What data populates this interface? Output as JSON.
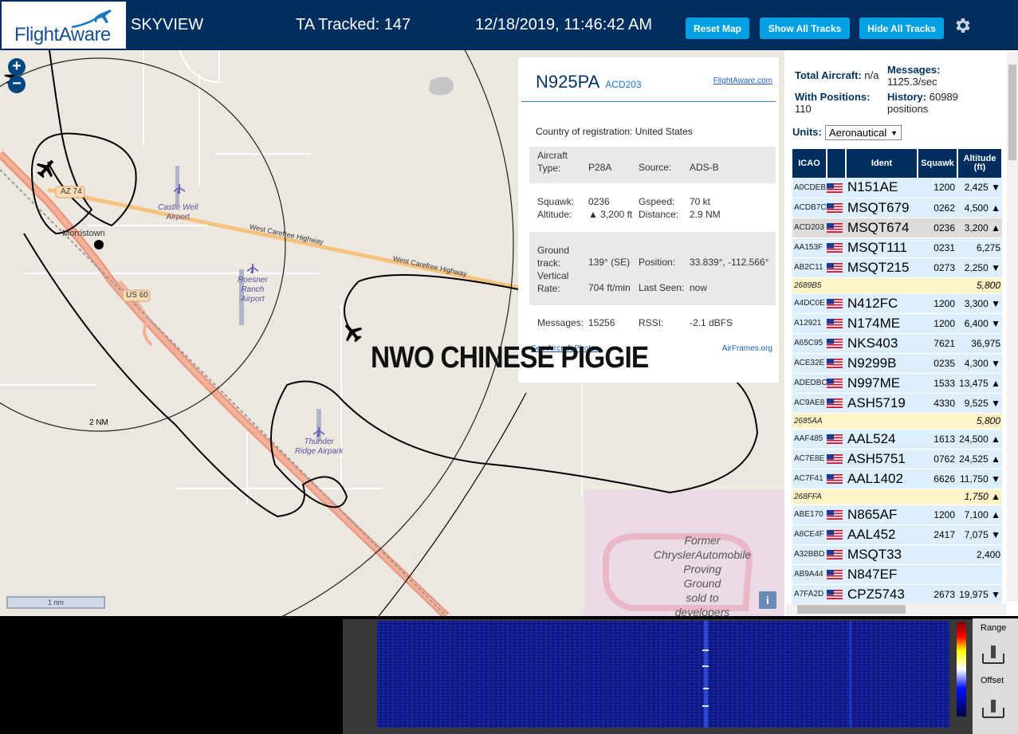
{
  "header": {
    "logo_text": "FlightAware",
    "app_title": "SKYVIEW",
    "tracked": "TA Tracked: 147",
    "clock": "12/18/2019, 11:46:42 AM",
    "reset_map": "Reset Map",
    "show_all_tracks": "Show All Tracks",
    "hide_all_tracks": "Hide All Tracks",
    "settings_icon": "gear-icon"
  },
  "map": {
    "zoom_in": "+",
    "zoom_out": "−",
    "labels": {
      "morristown": "Morristown",
      "az74": "AZ 74",
      "us60": "US 60",
      "highway1": "West Carefree Highway",
      "highway2": "West Carefree Highway",
      "castle_well": "Castle Well\nAirport",
      "roesner": "Roesner\nRanch\nAirport",
      "thunder_ridge": "Thunder\nRidge Airpark",
      "former": "Former\nChryslerAutomobile\nProving\nGround\nsold to\ndevelopers",
      "ring": "2 NM",
      "scale": "1 nm",
      "info": "i"
    },
    "overlay_text": "NWO CHINESE PIGGIE"
  },
  "selected_plane": {
    "callsign": "N925PA",
    "hex": "ACD203",
    "fa_link": "FlightAware.com",
    "country_label": "Country of registration:",
    "country": "United States",
    "aircraft_type_label": "Aircraft\nType:",
    "aircraft_type": "P28A",
    "source_label": "Source:",
    "source": "ADS-B",
    "squawk_label": "Squawk:",
    "squawk": "0236",
    "altitude_label": "Altitude:",
    "altitude": "▲ 3,200 ft",
    "gspeed_label": "Gspeed:",
    "gspeed": "70 kt",
    "distance_label": "Distance:",
    "distance": "2.9 NM",
    "ground_track_label": "Ground\ntrack:",
    "ground_track": "139° (SE)",
    "position_label": "Position:",
    "position": "33.839°, -112.566°",
    "vertical_rate_label": "Vertical\nRate:",
    "vertical_rate": "704 ft/min",
    "last_seen_label": "Last Seen:",
    "last_seen": "now",
    "messages_label": "Messages:",
    "messages": "15256",
    "rssi_label": "RSSI:",
    "rssi": "-2.1 dBFS",
    "see_photos": "See Aircraft Photos",
    "airframes": "AirFrames.org"
  },
  "sidebar": {
    "total_aircraft_label": "Total Aircraft:",
    "total_aircraft": "n/a",
    "messages_label": "Messages:",
    "messages": "1125.3/sec",
    "with_positions_label": "With Positions:",
    "with_positions": "110",
    "history_label": "History:",
    "history": "60989\npositions",
    "units_label": "Units:",
    "units_value": "Aeronautical",
    "columns": [
      "ICAO",
      "",
      "Ident",
      "Squawk",
      "Altitude\n(ft)"
    ],
    "rows": [
      {
        "icao": "A0CDEB",
        "ident": "N151AE",
        "squawk": "1200",
        "alt": "2,425 ▼",
        "flag": true,
        "kind": "normal"
      },
      {
        "icao": "ACDB7C",
        "ident": "MSQT679",
        "squawk": "0262",
        "alt": "4,500 ▲",
        "flag": true,
        "kind": "normal"
      },
      {
        "icao": "ACD203",
        "ident": "MSQT674",
        "squawk": "0236",
        "alt": "3,200 ▲",
        "flag": true,
        "kind": "selected"
      },
      {
        "icao": "AA153F",
        "ident": "MSQT111",
        "squawk": "0231",
        "alt": "6,275",
        "flag": true,
        "kind": "normal"
      },
      {
        "icao": "AB2C11",
        "ident": "MSQT215",
        "squawk": "0273",
        "alt": "2,250 ▼",
        "flag": true,
        "kind": "normal"
      },
      {
        "icao": "2689B5",
        "ident": "",
        "squawk": "",
        "alt": "5,800",
        "flag": false,
        "kind": "nopos"
      },
      {
        "icao": "A4DC0E",
        "ident": "N412FC",
        "squawk": "1200",
        "alt": "3,300 ▼",
        "flag": true,
        "kind": "normal"
      },
      {
        "icao": "A12921",
        "ident": "N174ME",
        "squawk": "1200",
        "alt": "6,400 ▼",
        "flag": true,
        "kind": "normal"
      },
      {
        "icao": "A65C95",
        "ident": "NKS403",
        "squawk": "7621",
        "alt": "36,975",
        "flag": true,
        "kind": "normal"
      },
      {
        "icao": "ACE32E",
        "ident": "N9299B",
        "squawk": "0235",
        "alt": "4,300 ▼",
        "flag": true,
        "kind": "normal"
      },
      {
        "icao": "ADEDBC",
        "ident": "N997ME",
        "squawk": "1533",
        "alt": "13,475 ▲",
        "flag": true,
        "kind": "normal"
      },
      {
        "icao": "AC9AE8",
        "ident": "ASH5719",
        "squawk": "4330",
        "alt": "9,525 ▼",
        "flag": true,
        "kind": "normal"
      },
      {
        "icao": "2685AA",
        "ident": "",
        "squawk": "",
        "alt": "5,800",
        "flag": false,
        "kind": "nopos"
      },
      {
        "icao": "AAF485",
        "ident": "AAL524",
        "squawk": "1613",
        "alt": "24,500 ▲",
        "flag": true,
        "kind": "normal"
      },
      {
        "icao": "AC7E8E",
        "ident": "ASH5751",
        "squawk": "0762",
        "alt": "24,525 ▲",
        "flag": true,
        "kind": "normal"
      },
      {
        "icao": "AC7F41",
        "ident": "AAL1402",
        "squawk": "6626",
        "alt": "11,750 ▼",
        "flag": true,
        "kind": "normal"
      },
      {
        "icao": "268FFA",
        "ident": "",
        "squawk": "",
        "alt": "1,750 ▲",
        "flag": false,
        "kind": "nopos"
      },
      {
        "icao": "ABE170",
        "ident": "N865AF",
        "squawk": "1200",
        "alt": "7,100 ▲",
        "flag": true,
        "kind": "normal"
      },
      {
        "icao": "A8CE4F",
        "ident": "AAL452",
        "squawk": "2417",
        "alt": "7,075 ▼",
        "flag": true,
        "kind": "normal"
      },
      {
        "icao": "A32BBD",
        "ident": "MSQT33",
        "squawk": "",
        "alt": "2,400",
        "flag": true,
        "kind": "normal"
      },
      {
        "icao": "AB9A44",
        "ident": "N847EF",
        "squawk": "",
        "alt": "",
        "flag": true,
        "kind": "normal"
      },
      {
        "icao": "A7FA2D",
        "ident": "CPZ5743",
        "squawk": "2673",
        "alt": "19,975 ▼",
        "flag": true,
        "kind": "normal"
      }
    ]
  },
  "bottom": {
    "range_label": "Range",
    "offset_label": "Offset"
  }
}
